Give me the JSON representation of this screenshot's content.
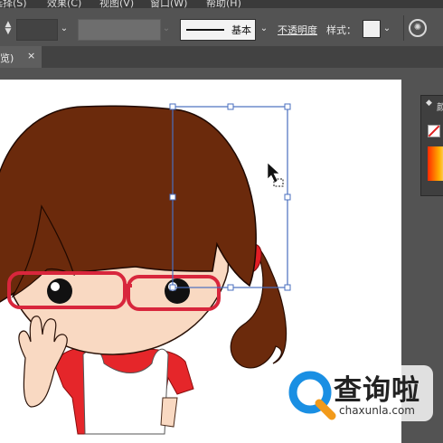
{
  "menu": {
    "items": [
      "选择(S)",
      "效果(C)",
      "视图(V)",
      "窗口(W)",
      "帮助(H)"
    ]
  },
  "control_bar": {
    "stroke_profile_label": "基本",
    "opacity_label": "不透明度",
    "style_label": "样式："
  },
  "tab": {
    "label": "览)",
    "close": "×"
  },
  "panel": {
    "title_fragment": "颜"
  },
  "watermark": {
    "chinese": "查询啦",
    "url": "chaxunla.com"
  },
  "icons": [
    "stepper-icon",
    "chevron-down-icon",
    "transparency-settings-icon",
    "close-icon",
    "direct-selection-cursor-icon",
    "search-logo-icon"
  ],
  "colors": {
    "hair": "#6b2a0c",
    "skin": "#f9d9c2",
    "glasses": "#d8263c",
    "shirt": "#e5262a",
    "hair_tie": "#e21e26",
    "selection": "#4a6fbf",
    "watermark_blue": "#1a8fe3",
    "watermark_orange": "#f29a1a"
  }
}
